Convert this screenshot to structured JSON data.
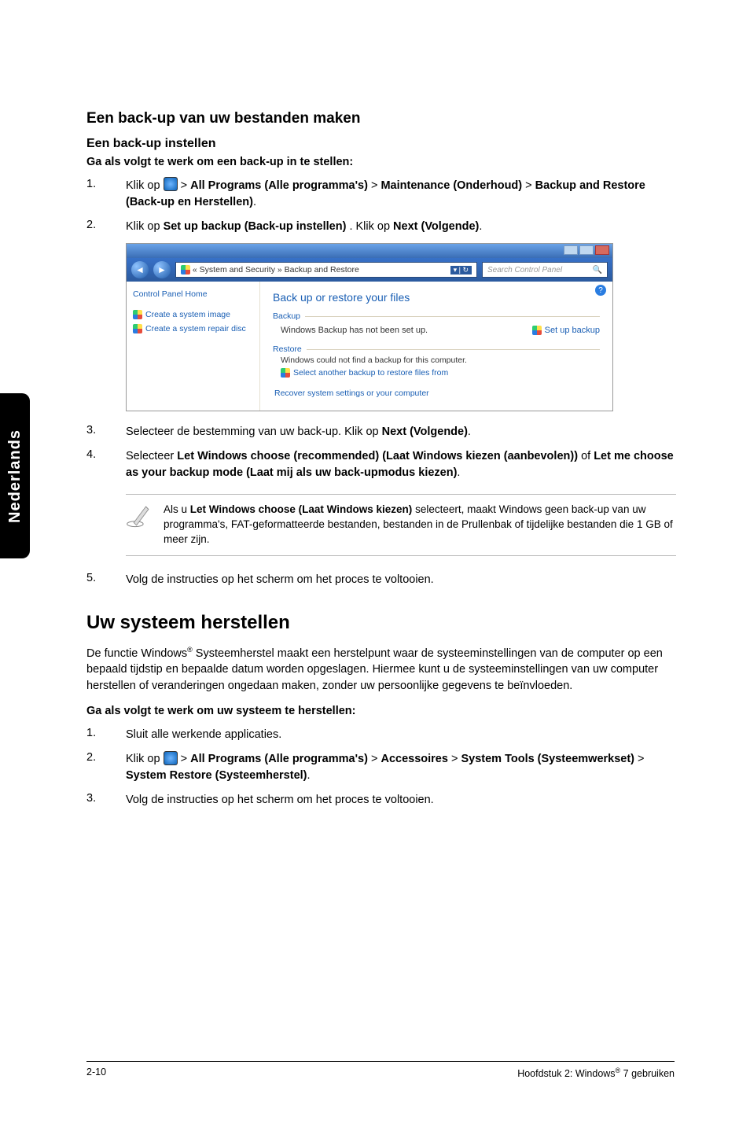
{
  "sidetab": "Nederlands",
  "h_backup_files": "Een back-up van uw bestanden maken",
  "h_setup_backup": "Een back-up instellen",
  "intro_setup": "Ga als volgt te werk om een back-up in te stellen:",
  "steps_a": {
    "s1_pre": "Klik op ",
    "s1_allprog": "All Programs (Alle programma's)",
    "s1_maint": "Maintenance (Onderhoud)",
    "s1_bar": "Backup and Restore (Back-up en Herstellen)",
    "s2_pre": "Klik op ",
    "s2_setup": "Set up backup (Back-up instellen)",
    "s2_mid": ". Klik op ",
    "s2_next": "Next (Volgende)",
    "s3_pre": "Selecteer de bestemming van uw back-up. Klik op ",
    "s3_next": "Next (Volgende)",
    "s4_pre": "Selecteer ",
    "s4_let": "Let Windows choose (recommended) (Laat Windows kiezen (aanbevolen))",
    "s4_of": " of ",
    "s4_me": "Let me choose as your backup mode (Laat mij als uw back-upmodus kiezen)",
    "s5": "Volg de instructies op het scherm om het proces te voltooien."
  },
  "screenshot": {
    "crumb": "« System and Security » Backup and Restore",
    "search_placeholder": "Search Control Panel",
    "left_home": "Control Panel Home",
    "left_img": "Create a system image",
    "left_disc": "Create a system repair disc",
    "title": "Back up or restore your files",
    "grp_backup": "Backup",
    "backup_status": "Windows Backup has not been set up.",
    "setup_link": "Set up backup",
    "grp_restore": "Restore",
    "restore_l1": "Windows could not find a backup for this computer.",
    "restore_l2": "Select another backup to restore files from",
    "recover": "Recover system settings or your computer"
  },
  "note_pre": "Als u ",
  "note_bold": "Let Windows choose (Laat Windows kiezen)",
  "note_post": " selecteert, maakt Windows geen back-up van uw programma's, FAT-geformatteerde bestanden, bestanden in de Prullenbak of tijdelijke bestanden die 1 GB of meer zijn.",
  "h_restore": "Uw systeem herstellen",
  "restore_para_a": "De functie Windows",
  "restore_para_b": " Systeemherstel maakt een herstelpunt waar de systeeminstellingen van de computer op een bepaald tijdstip en bepaalde datum worden opgeslagen. Hiermee kunt u de systeeminstellingen van uw computer herstellen of veranderingen ongedaan maken, zonder uw persoonlijke gegevens te beïnvloeden.",
  "intro_restore": "Ga als volgt te werk om uw systeem te herstellen:",
  "steps_b": {
    "s1": "Sluit alle werkende applicaties.",
    "s2_pre": "Klik op ",
    "s2_allprog": "All Programs (Alle programma's)",
    "s2_acc": "Accessoires",
    "s2_tools": "System Tools (Systeemwerkset)",
    "s2_sr": "System Restore (Systeemherstel)",
    "s3": "Volg de instructies op het scherm om het proces te voltooien."
  },
  "footer_left": "2-10",
  "footer_right_a": "Hoofdstuk 2: Windows",
  "footer_right_b": " 7 gebruiken"
}
